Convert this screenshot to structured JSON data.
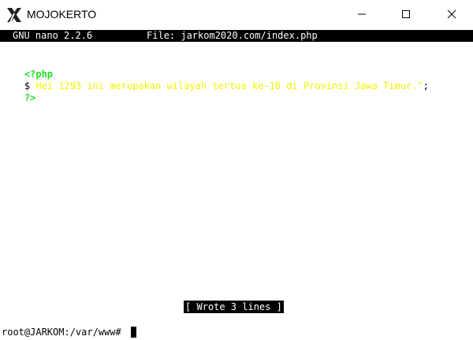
{
  "window": {
    "title": "MOJOKERTO",
    "icon": "x-server-icon"
  },
  "nano": {
    "version": "GNU nano 2.2.6",
    "file_label": "File: jarkom2020.com/index.php"
  },
  "editor_lines": {
    "open_tag": "<?php",
    "echo_prefix": "$",
    "echo_string": " Hei 1293 ini merupakan wilayah tertua ke-10 di Provinsi Jawa Timur.\"",
    "echo_suffix": ";",
    "close_tag": "?>"
  },
  "status": "[ Wrote 3 lines ]",
  "shell": {
    "prompt": "root@JARKOM:/var/www# "
  },
  "colors": {
    "php_tag": "#22e022",
    "string": "#f2f200",
    "bar_bg": "#000000",
    "bar_fg": "#ffffff"
  }
}
